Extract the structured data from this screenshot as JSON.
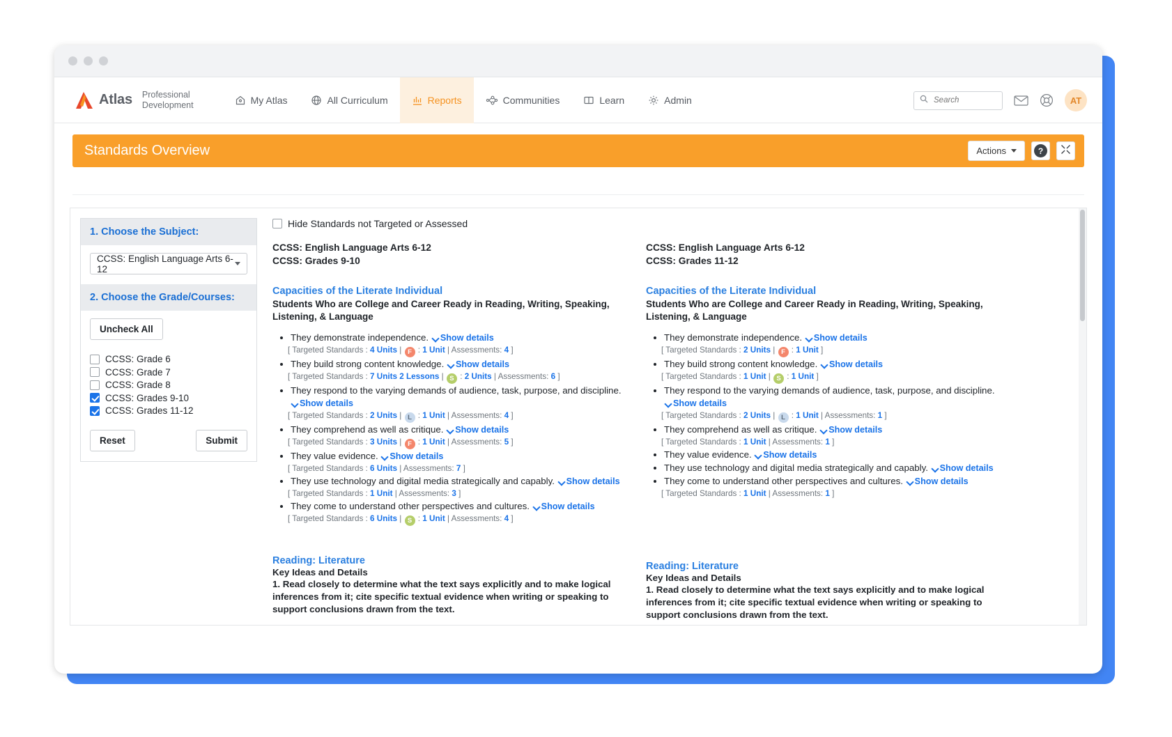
{
  "brand": {
    "name": "Atlas",
    "sub_line1": "Professional",
    "sub_line2": "Development"
  },
  "nav": [
    {
      "label": "My Atlas",
      "icon": "home-icon",
      "active": false
    },
    {
      "label": "All Curriculum",
      "icon": "globe-icon",
      "active": false
    },
    {
      "label": "Reports",
      "icon": "chart-icon",
      "active": true
    },
    {
      "label": "Communities",
      "icon": "network-icon",
      "active": false
    },
    {
      "label": "Learn",
      "icon": "book-icon",
      "active": false
    },
    {
      "label": "Admin",
      "icon": "gear-icon",
      "active": false
    }
  ],
  "search": {
    "placeholder": "Search",
    "value": ""
  },
  "user": {
    "initials": "AT"
  },
  "banner": {
    "title": "Standards Overview",
    "actions_label": "Actions",
    "help_label": "?",
    "expand_label": "expand"
  },
  "sidebar": {
    "step1_title": "1. Choose the Subject:",
    "subject_value": "CCSS: English Language Arts 6-12",
    "step2_title": "2. Choose the Grade/Courses:",
    "uncheck_all_label": "Uncheck All",
    "grades": [
      {
        "label": "CCSS: Grade 6",
        "checked": false
      },
      {
        "label": "CCSS: Grade 7",
        "checked": false
      },
      {
        "label": "CCSS: Grade 8",
        "checked": false
      },
      {
        "label": "CCSS: Grades 9-10",
        "checked": true
      },
      {
        "label": "CCSS: Grades 11-12",
        "checked": true
      }
    ],
    "reset_label": "Reset",
    "submit_label": "Submit"
  },
  "report": {
    "hide_checkbox_label": "Hide Standards not Targeted or Assessed",
    "hide_checked": false,
    "show_details_label": "Show details",
    "targeted_prefix": "[ Targeted Standards : ",
    "assessments_label": "Assessments:",
    "columns": [
      {
        "crumb_line1": "CCSS: English Language Arts 6-12",
        "crumb_line2": "CCSS: Grades 9-10",
        "section_title": "Capacities of the Literate Individual",
        "section_subtitle": "Students Who are College and Career Ready in Reading, Writing, Speaking, Listening, & Language",
        "bullets": [
          {
            "text": "They demonstrate independence.",
            "units": "4 Units",
            "badge": "F",
            "badge_units": "1 Unit",
            "assessments": "4"
          },
          {
            "text": "They build strong content knowledge.",
            "units": "7 Units 2 Lessons",
            "badge": "S",
            "badge_units": "2 Units",
            "assessments": "6"
          },
          {
            "text": "They respond to the varying demands of audience, task, purpose, and discipline.",
            "units": "2 Units",
            "badge": "L",
            "badge_units": "1 Unit",
            "assessments": "4"
          },
          {
            "text": "They comprehend as well as critique.",
            "units": "3 Units",
            "badge": "F",
            "badge_units": "1 Unit",
            "assessments": "5"
          },
          {
            "text": "They value evidence.",
            "units": "6 Units",
            "badge": "",
            "badge_units": "",
            "assessments": "7"
          },
          {
            "text": "They use technology and digital media strategically and capably.",
            "units": "1 Unit",
            "badge": "",
            "badge_units": "",
            "assessments": "3"
          },
          {
            "text": "They come to understand other perspectives and cultures.",
            "units": "6 Units",
            "badge": "S",
            "badge_units": "1 Unit",
            "assessments": "4"
          }
        ],
        "lit_title": "Reading: Literature",
        "lit_sub": "Key Ideas and Details",
        "lit_body": "1. Read closely to determine what the text says explicitly and to make logical inferences from it; cite specific textual evidence when writing or speaking to support conclusions drawn from the text."
      },
      {
        "crumb_line1": "CCSS: English Language Arts 6-12",
        "crumb_line2": "CCSS: Grades 11-12",
        "section_title": "Capacities of the Literate Individual",
        "section_subtitle": "Students Who are College and Career Ready in Reading, Writing, Speaking, Listening, & Language",
        "bullets": [
          {
            "text": "They demonstrate independence.",
            "units": "2 Units",
            "badge": "F",
            "badge_units": "1 Unit",
            "assessments": ""
          },
          {
            "text": "They build strong content knowledge.",
            "units": "1 Unit",
            "badge": "S",
            "badge_units": "1 Unit",
            "assessments": ""
          },
          {
            "text": "They respond to the varying demands of audience, task, purpose, and discipline.",
            "units": "2 Units",
            "badge": "L",
            "badge_units": "1 Unit",
            "assessments": "1"
          },
          {
            "text": "They comprehend as well as critique.",
            "units": "1 Unit",
            "badge": "",
            "badge_units": "",
            "assessments": "1"
          },
          {
            "text": "They value evidence.",
            "units": "",
            "badge": "",
            "badge_units": "",
            "assessments": ""
          },
          {
            "text": "They use technology and digital media strategically and capably.",
            "units": "",
            "badge": "",
            "badge_units": "",
            "assessments": ""
          },
          {
            "text": "They come to understand other perspectives and cultures.",
            "units": "1 Unit",
            "badge": "",
            "badge_units": "",
            "assessments": "1"
          }
        ],
        "lit_title": "Reading: Literature",
        "lit_sub": "Key Ideas and Details",
        "lit_body": "1. Read closely to determine what the text says explicitly and to make logical inferences from it; cite specific textual evidence when writing or speaking to support conclusions drawn from the text."
      }
    ]
  },
  "colors": {
    "accent_orange": "#f99f2a",
    "link_blue": "#1a73e8",
    "heading_blue": "#2a7fe0",
    "badge_f": "#f4866b",
    "badge_s": "#b5ce6a",
    "badge_l": "#c8d9ec",
    "frame_blue": "#4285f4"
  }
}
